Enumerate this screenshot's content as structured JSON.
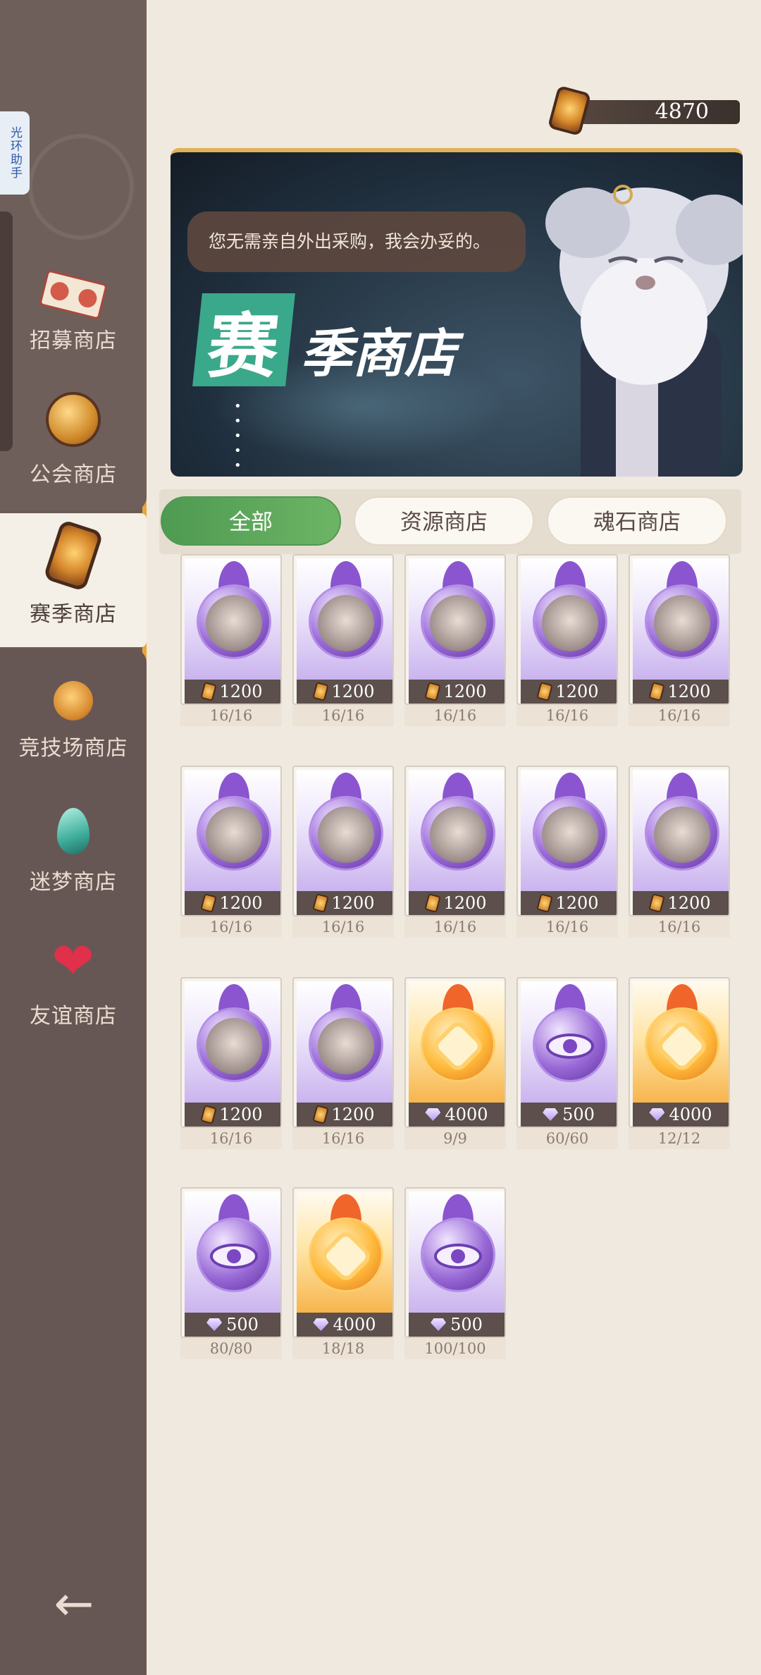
{
  "helper_tab": "光环助手",
  "currency": {
    "amount": "4870"
  },
  "sidebar": {
    "items": [
      {
        "label": "招募商店",
        "icon": "recruit-ticket-icon"
      },
      {
        "label": "公会商店",
        "icon": "guild-medal-icon"
      },
      {
        "label": "赛季商店",
        "icon": "season-token-icon",
        "active": true
      },
      {
        "label": "竞技场商店",
        "icon": "arena-coin-icon"
      },
      {
        "label": "迷梦商店",
        "icon": "dream-drop-icon"
      },
      {
        "label": "友谊商店",
        "icon": "friendship-heart-icon"
      }
    ],
    "back_icon": "back-arrow-icon"
  },
  "banner": {
    "speech": "您无需亲自外出采购，我会办妥的。",
    "title_big": "赛",
    "title_rest": "季商店",
    "dots": "• • • • • • •"
  },
  "tabs": [
    {
      "label": "全部",
      "active": true
    },
    {
      "label": "资源商店"
    },
    {
      "label": "魂石商店"
    }
  ],
  "items": [
    {
      "price": "1200",
      "currency": "token",
      "stock": "16/16",
      "kind": "portrait"
    },
    {
      "price": "1200",
      "currency": "token",
      "stock": "16/16",
      "kind": "portrait"
    },
    {
      "price": "1200",
      "currency": "token",
      "stock": "16/16",
      "kind": "portrait"
    },
    {
      "price": "1200",
      "currency": "token",
      "stock": "16/16",
      "kind": "portrait"
    },
    {
      "price": "1200",
      "currency": "token",
      "stock": "16/16",
      "kind": "portrait"
    },
    {
      "price": "1200",
      "currency": "token",
      "stock": "16/16",
      "kind": "portrait"
    },
    {
      "price": "1200",
      "currency": "token",
      "stock": "16/16",
      "kind": "portrait"
    },
    {
      "price": "1200",
      "currency": "token",
      "stock": "16/16",
      "kind": "portrait"
    },
    {
      "price": "1200",
      "currency": "token",
      "stock": "16/16",
      "kind": "portrait"
    },
    {
      "price": "1200",
      "currency": "token",
      "stock": "16/16",
      "kind": "portrait"
    },
    {
      "price": "1200",
      "currency": "token",
      "stock": "16/16",
      "kind": "portrait"
    },
    {
      "price": "1200",
      "currency": "token",
      "stock": "16/16",
      "kind": "portrait"
    },
    {
      "price": "4000",
      "currency": "diamond",
      "stock": "9/9",
      "kind": "gold"
    },
    {
      "price": "500",
      "currency": "diamond",
      "stock": "60/60",
      "kind": "purple-eye"
    },
    {
      "price": "4000",
      "currency": "diamond",
      "stock": "12/12",
      "kind": "gold"
    },
    {
      "price": "500",
      "currency": "diamond",
      "stock": "80/80",
      "kind": "purple-eye"
    },
    {
      "price": "4000",
      "currency": "diamond",
      "stock": "18/18",
      "kind": "gold"
    },
    {
      "price": "500",
      "currency": "diamond",
      "stock": "100/100",
      "kind": "purple-eye"
    }
  ],
  "colors": {
    "accent_green": "#4e9a52",
    "sidebar_bg": "#6b5b57",
    "sidebar_border": "#e8a63a",
    "page_bg": "#efe9df"
  }
}
